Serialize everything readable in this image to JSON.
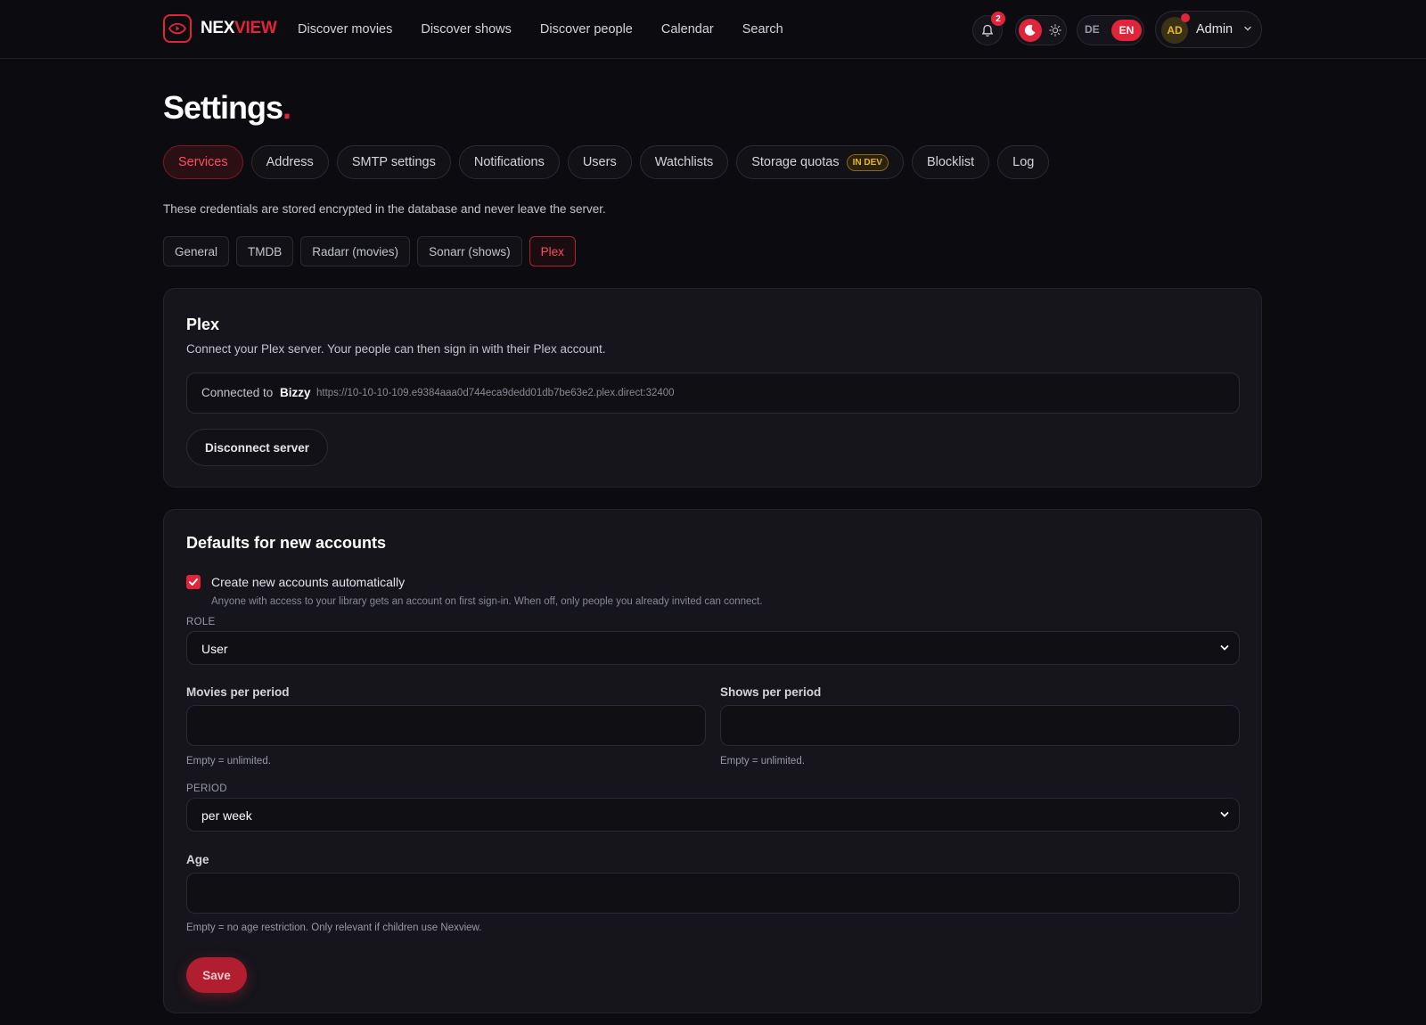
{
  "brand": {
    "part1": "NEX",
    "part2": "VIEW"
  },
  "nav": [
    "Discover movies",
    "Discover shows",
    "Discover people",
    "Calendar",
    "Search"
  ],
  "header": {
    "notification_count": "2",
    "lang_de": "DE",
    "lang_en": "EN",
    "avatar_initials": "AD",
    "user_name": "Admin"
  },
  "page": {
    "title": "Settings",
    "title_dot": "."
  },
  "tabs": [
    {
      "label": "Services"
    },
    {
      "label": "Address"
    },
    {
      "label": "SMTP settings"
    },
    {
      "label": "Notifications"
    },
    {
      "label": "Users"
    },
    {
      "label": "Watchlists"
    },
    {
      "label": "Storage quotas",
      "badge": "IN DEV"
    },
    {
      "label": "Blocklist"
    },
    {
      "label": "Log"
    }
  ],
  "credentials_note": "These credentials are stored encrypted in the database and never leave the server.",
  "subtabs": [
    "General",
    "TMDB",
    "Radarr (movies)",
    "Sonarr (shows)",
    "Plex"
  ],
  "plex": {
    "title": "Plex",
    "description": "Connect your Plex server. Your people can then sign in with their Plex account.",
    "connected_label": "Connected to",
    "server_name": "Bizzy",
    "server_url": "https://10-10-10-109.e9384aaa0d744eca9dedd01db7be63e2.plex.direct:32400",
    "disconnect_label": "Disconnect server"
  },
  "defaults": {
    "title": "Defaults for new accounts",
    "auto_create_label": "Create new accounts automatically",
    "auto_create_checked": true,
    "auto_create_help": "Anyone with access to your library gets an account on first sign-in. When off, only people you already invited can connect.",
    "role_label": "ROLE",
    "role_value": "User",
    "movies_label": "Movies per period",
    "movies_value": "",
    "movies_help": "Empty = unlimited.",
    "shows_label": "Shows per period",
    "shows_value": "",
    "shows_help": "Empty = unlimited.",
    "period_label": "PERIOD",
    "period_value": "per week",
    "age_label": "Age",
    "age_value": "",
    "age_help": "Empty = no age restriction. Only relevant if children use Nexview.",
    "save_label": "Save"
  },
  "colors": {
    "accent": "#e0243a",
    "background": "#0c0c10",
    "card": "#15151b",
    "badge": "#e8b62c"
  }
}
